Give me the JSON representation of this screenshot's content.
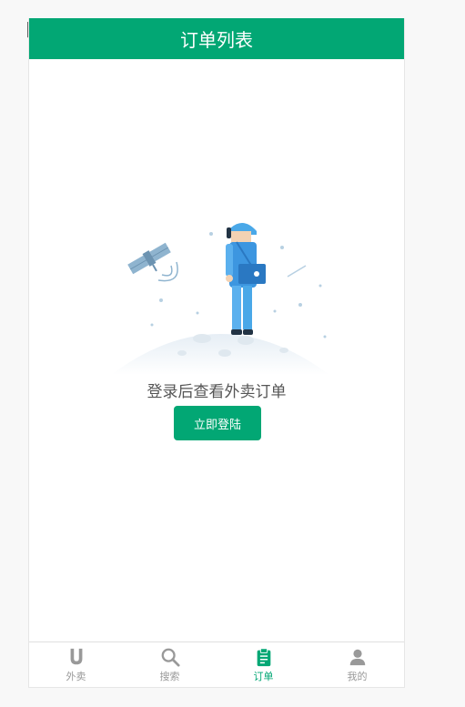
{
  "header": {
    "title": "订单列表"
  },
  "empty_state": {
    "message": "登录后查看外卖订单",
    "login_button": "立即登陆"
  },
  "tabs": [
    {
      "label": "外卖",
      "icon": "takeout-icon",
      "active": false
    },
    {
      "label": "搜索",
      "icon": "search-icon",
      "active": false
    },
    {
      "label": "订单",
      "icon": "order-icon",
      "active": true
    },
    {
      "label": "我的",
      "icon": "profile-icon",
      "active": false
    }
  ],
  "colors": {
    "brand": "#02a774",
    "inactive": "#999999"
  }
}
